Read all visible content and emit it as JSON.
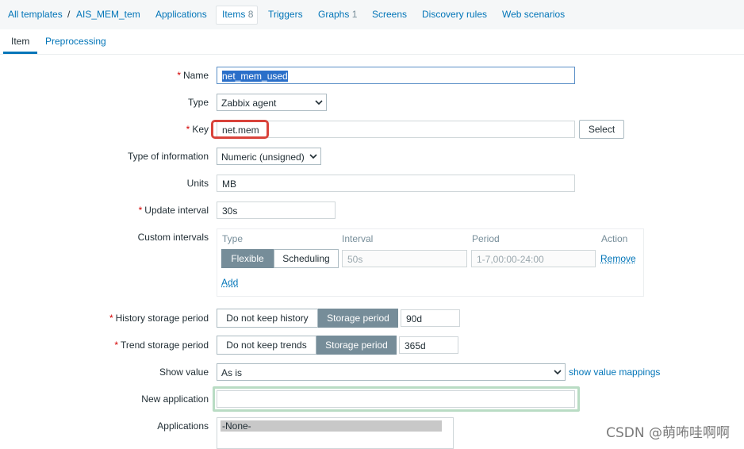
{
  "nav": {
    "all_templates": "All templates",
    "separator": "/",
    "template": "AIS_MEM_tem",
    "applications": "Applications",
    "items": "Items",
    "items_count": "8",
    "triggers": "Triggers",
    "graphs": "Graphs",
    "graphs_count": "1",
    "screens": "Screens",
    "discovery_rules": "Discovery rules",
    "web_scenarios": "Web scenarios"
  },
  "subtabs": {
    "item": "Item",
    "preprocessing": "Preprocessing"
  },
  "form": {
    "required_mark": "*",
    "name_label": "Name",
    "name_value": "net_mem_used",
    "type_label": "Type",
    "type_value": "Zabbix agent",
    "key_label": "Key",
    "key_value": "net.mem",
    "select_button": "Select",
    "type_of_info_label": "Type of information",
    "type_of_info_value": "Numeric (unsigned)",
    "units_label": "Units",
    "units_value": "MB",
    "update_interval_label": "Update interval",
    "update_interval_value": "30s",
    "custom_intervals_label": "Custom intervals",
    "custom_intervals": {
      "col_type": "Type",
      "col_interval": "Interval",
      "col_period": "Period",
      "col_action": "Action",
      "flexible": "Flexible",
      "scheduling": "Scheduling",
      "interval_placeholder": "50s",
      "period_placeholder": "1-7,00:00-24:00",
      "remove": "Remove",
      "add": "Add"
    },
    "history_label": "History storage period",
    "history_no_keep": "Do not keep history",
    "history_storage": "Storage period",
    "history_value": "90d",
    "trend_label": "Trend storage period",
    "trend_no_keep": "Do not keep trends",
    "trend_storage": "Storage period",
    "trend_value": "365d",
    "show_value_label": "Show value",
    "show_value_value": "As is",
    "show_value_mappings": "show value mappings",
    "new_application_label": "New application",
    "new_application_value": "",
    "applications_label": "Applications",
    "applications_options": [
      "-None-"
    ]
  },
  "watermark": "CSDN @萌咘哇啊啊",
  "colors": {
    "link": "#0275b8",
    "required": "#d40000",
    "segment_active": "#768d99",
    "highlight": "#d9433b",
    "focus_border": "#b9dcc4"
  }
}
